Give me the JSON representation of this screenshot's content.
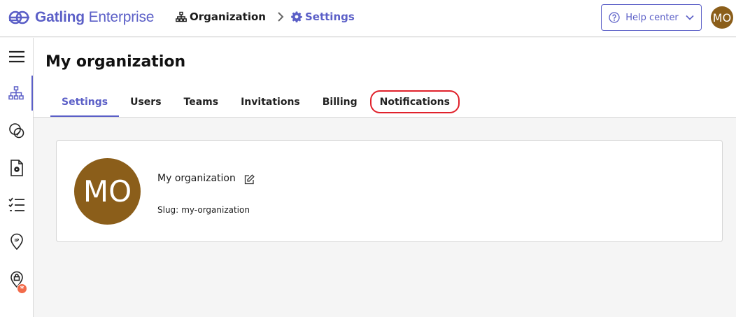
{
  "app": {
    "brand_bold": "Gatling",
    "brand_light": " Enterprise",
    "brand_color": "#5b5fc7"
  },
  "breadcrumb": {
    "items": [
      {
        "label": "Organization",
        "icon": "sitemap-icon"
      },
      {
        "label": "Settings",
        "icon": "gear-icon"
      }
    ],
    "separator_icon": "chevron-right-icon"
  },
  "header": {
    "help_label": "Help center",
    "help_icon": "question-circle-icon",
    "user_initials": "MO",
    "avatar_color": "#8b5e1a"
  },
  "sidebar": {
    "items": [
      {
        "name": "menu",
        "icon": "hamburger-menu-icon"
      },
      {
        "name": "organization",
        "icon": "sitemap-icon",
        "active": true
      },
      {
        "name": "simulations",
        "icon": "overlapping-circles-icon"
      },
      {
        "name": "packages",
        "icon": "file-gear-icon"
      },
      {
        "name": "runs",
        "icon": "checklist-icon"
      },
      {
        "name": "ip-locations",
        "icon": "ip-pin-icon"
      },
      {
        "name": "private-locations",
        "icon": "lock-pin-icon",
        "badge": "*"
      }
    ]
  },
  "page": {
    "title": "My organization",
    "tabs": [
      {
        "label": "Settings",
        "active": true
      },
      {
        "label": "Users"
      },
      {
        "label": "Teams"
      },
      {
        "label": "Invitations"
      },
      {
        "label": "Billing"
      },
      {
        "label": "Notifications",
        "highlighted": true
      }
    ]
  },
  "organization": {
    "initials": "MO",
    "name": "My organization",
    "slug_label": "Slug:",
    "slug_value": "my-organization"
  }
}
